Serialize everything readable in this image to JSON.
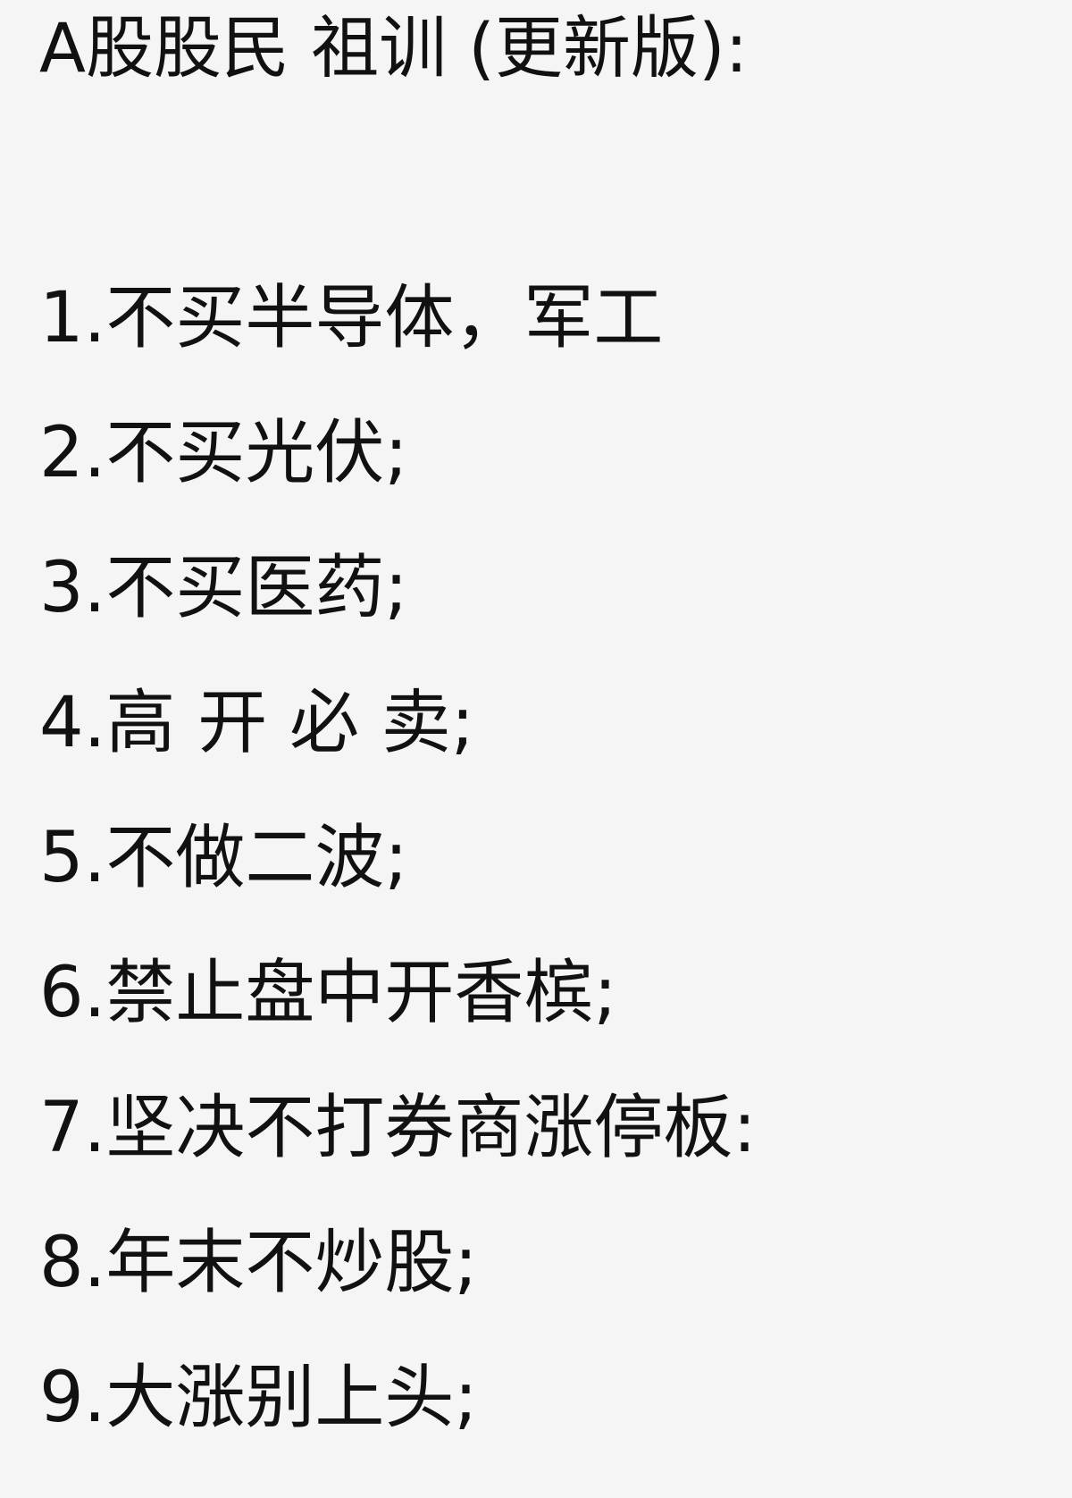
{
  "title": "A股股民 祖训 (更新版):",
  "rules": [
    "1.不买半导体，军工",
    "2.不买光伏;",
    "3.不买医药;",
    "4.高 开 必 卖;",
    "5.不做二波;",
    "6.禁止盘中开香槟;",
    "7.坚决不打券商涨停板:",
    "8.年末不炒股;",
    "9.大涨别上头;"
  ]
}
